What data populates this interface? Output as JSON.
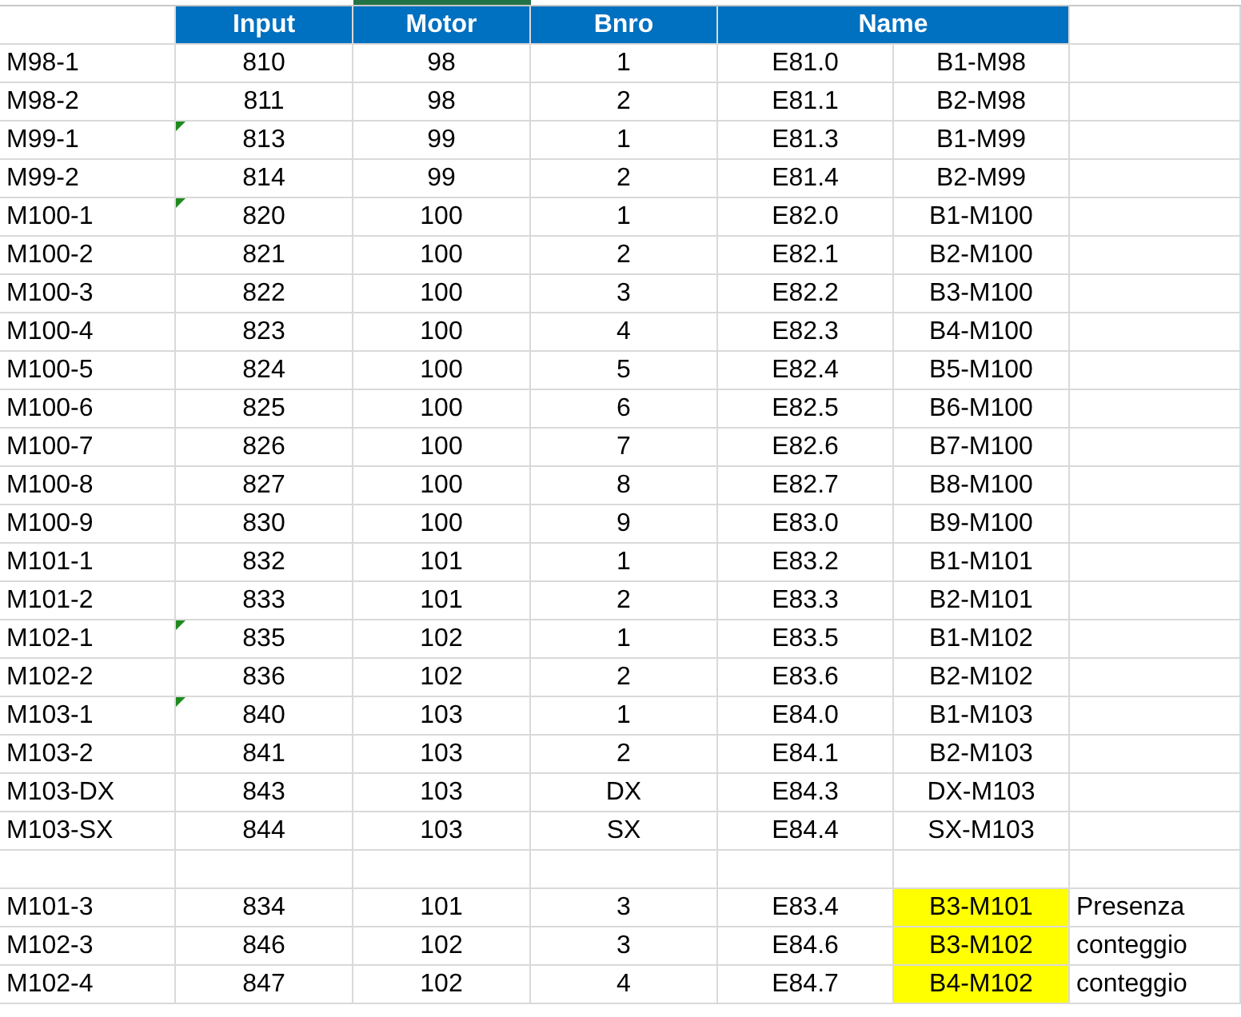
{
  "header": {
    "input": "Input",
    "motor": "Motor",
    "bnro": "Bnro",
    "name": "Name"
  },
  "rows": [
    {
      "kind": "data",
      "label": "M98-1",
      "input": "810",
      "motor": "98",
      "bnro": "1",
      "address": "E81.0",
      "name": "B1-M98",
      "flagged": false,
      "highlighted": false
    },
    {
      "kind": "data",
      "label": "M98-2",
      "input": "811",
      "motor": "98",
      "bnro": "2",
      "address": "E81.1",
      "name": "B2-M98",
      "flagged": false,
      "highlighted": false
    },
    {
      "kind": "data",
      "label": "M99-1",
      "input": "813",
      "motor": "99",
      "bnro": "1",
      "address": "E81.3",
      "name": "B1-M99",
      "flagged": true,
      "highlighted": false
    },
    {
      "kind": "data",
      "label": "M99-2",
      "input": "814",
      "motor": "99",
      "bnro": "2",
      "address": "E81.4",
      "name": "B2-M99",
      "flagged": false,
      "highlighted": false
    },
    {
      "kind": "data",
      "label": "M100-1",
      "input": "820",
      "motor": "100",
      "bnro": "1",
      "address": "E82.0",
      "name": "B1-M100",
      "flagged": true,
      "highlighted": false
    },
    {
      "kind": "data",
      "label": "M100-2",
      "input": "821",
      "motor": "100",
      "bnro": "2",
      "address": "E82.1",
      "name": "B2-M100",
      "flagged": false,
      "highlighted": false
    },
    {
      "kind": "data",
      "label": "M100-3",
      "input": "822",
      "motor": "100",
      "bnro": "3",
      "address": "E82.2",
      "name": "B3-M100",
      "flagged": false,
      "highlighted": false
    },
    {
      "kind": "data",
      "label": "M100-4",
      "input": "823",
      "motor": "100",
      "bnro": "4",
      "address": "E82.3",
      "name": "B4-M100",
      "flagged": false,
      "highlighted": false
    },
    {
      "kind": "data",
      "label": "M100-5",
      "input": "824",
      "motor": "100",
      "bnro": "5",
      "address": "E82.4",
      "name": "B5-M100",
      "flagged": false,
      "highlighted": false
    },
    {
      "kind": "data",
      "label": "M100-6",
      "input": "825",
      "motor": "100",
      "bnro": "6",
      "address": "E82.5",
      "name": "B6-M100",
      "flagged": false,
      "highlighted": false
    },
    {
      "kind": "data",
      "label": "M100-7",
      "input": "826",
      "motor": "100",
      "bnro": "7",
      "address": "E82.6",
      "name": "B7-M100",
      "flagged": false,
      "highlighted": false
    },
    {
      "kind": "data",
      "label": "M100-8",
      "input": "827",
      "motor": "100",
      "bnro": "8",
      "address": "E82.7",
      "name": "B8-M100",
      "flagged": false,
      "highlighted": false
    },
    {
      "kind": "data",
      "label": "M100-9",
      "input": "830",
      "motor": "100",
      "bnro": "9",
      "address": "E83.0",
      "name": "B9-M100",
      "flagged": false,
      "highlighted": false
    },
    {
      "kind": "data",
      "label": "M101-1",
      "input": "832",
      "motor": "101",
      "bnro": "1",
      "address": "E83.2",
      "name": "B1-M101",
      "flagged": false,
      "highlighted": false
    },
    {
      "kind": "data",
      "label": "M101-2",
      "input": "833",
      "motor": "101",
      "bnro": "2",
      "address": "E83.3",
      "name": "B2-M101",
      "flagged": false,
      "highlighted": false
    },
    {
      "kind": "data",
      "label": "M102-1",
      "input": "835",
      "motor": "102",
      "bnro": "1",
      "address": "E83.5",
      "name": "B1-M102",
      "flagged": true,
      "highlighted": false
    },
    {
      "kind": "data",
      "label": "M102-2",
      "input": "836",
      "motor": "102",
      "bnro": "2",
      "address": "E83.6",
      "name": "B2-M102",
      "flagged": false,
      "highlighted": false
    },
    {
      "kind": "data",
      "label": "M103-1",
      "input": "840",
      "motor": "103",
      "bnro": "1",
      "address": "E84.0",
      "name": "B1-M103",
      "flagged": true,
      "highlighted": false
    },
    {
      "kind": "data",
      "label": "M103-2",
      "input": "841",
      "motor": "103",
      "bnro": "2",
      "address": "E84.1",
      "name": "B2-M103",
      "flagged": false,
      "highlighted": false
    },
    {
      "kind": "data",
      "label": "M103-DX",
      "input": "843",
      "motor": "103",
      "bnro": "DX",
      "address": "E84.3",
      "name": "DX-M103",
      "flagged": false,
      "highlighted": false
    },
    {
      "kind": "data",
      "label": "M103-SX",
      "input": "844",
      "motor": "103",
      "bnro": "SX",
      "address": "E84.4",
      "name": "SX-M103",
      "flagged": false,
      "highlighted": false
    },
    {
      "kind": "blank"
    },
    {
      "kind": "data",
      "label": "M101-3",
      "input": "834",
      "motor": "101",
      "bnro": "3",
      "address": "E83.4",
      "name": "B3-M101",
      "note": "Presenza",
      "flagged": false,
      "highlighted": true
    },
    {
      "kind": "data",
      "label": "M102-3",
      "input": "846",
      "motor": "102",
      "bnro": "3",
      "address": "E84.6",
      "name": "B3-M102",
      "note": "conteggio",
      "flagged": false,
      "highlighted": true
    },
    {
      "kind": "data",
      "label": "M102-4",
      "input": "847",
      "motor": "102",
      "bnro": "4",
      "address": "E84.7",
      "name": "B4-M102",
      "note": "conteggio",
      "flagged": false,
      "highlighted": true
    }
  ]
}
